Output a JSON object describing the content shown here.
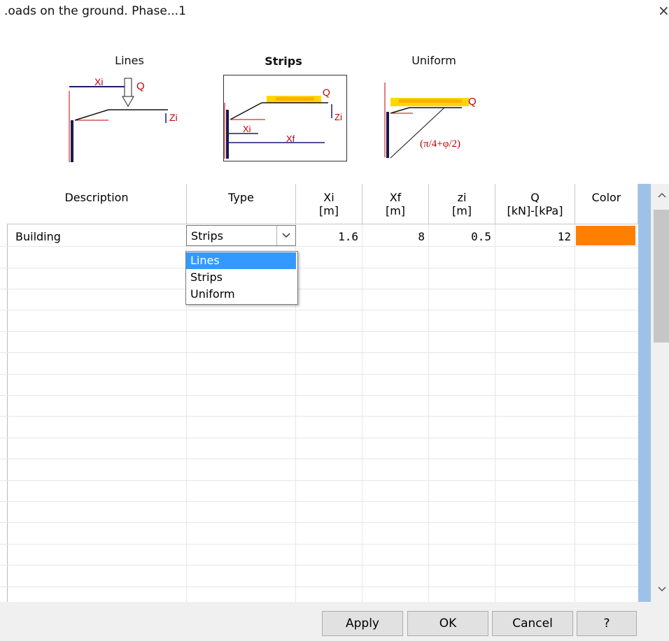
{
  "window": {
    "title": ".oads on the ground. Phase...1",
    "close_glyph": "×"
  },
  "diagrams": [
    {
      "label": "Lines",
      "bold": false,
      "labels": {
        "xi": "Xi",
        "q": "Q",
        "zi": "Zi"
      }
    },
    {
      "label": "Strips",
      "bold": true,
      "labels": {
        "xi": "Xi",
        "xf": "Xf",
        "q": "Q",
        "zi": "Zi"
      }
    },
    {
      "label": "Uniform",
      "bold": false,
      "labels": {
        "q": "Q",
        "angle": "(π/4+φ/2)"
      }
    }
  ],
  "table": {
    "columns": [
      {
        "label": "Description",
        "unit": ""
      },
      {
        "label": "Type",
        "unit": ""
      },
      {
        "label": "Xi",
        "unit": "[m]"
      },
      {
        "label": "Xf",
        "unit": "[m]"
      },
      {
        "label": "zi",
        "unit": "[m]"
      },
      {
        "label": "Q",
        "unit": "[kN]-[kPa]"
      },
      {
        "label": "Color",
        "unit": ""
      }
    ],
    "rows": [
      {
        "description": "Building",
        "type": "Strips",
        "xi": "1.6",
        "xf": "8",
        "zi": "0.5",
        "q": "12",
        "color": "#ff8000"
      }
    ]
  },
  "type_dropdown": {
    "options": [
      "Lines",
      "Strips",
      "Uniform"
    ],
    "highlighted": "Lines"
  },
  "buttons": {
    "apply": "Apply",
    "ok": "OK",
    "cancel": "Cancel",
    "help": "?"
  },
  "colors": {
    "selection": "#3399ff",
    "scrollbar_accent": "#9ec1ea",
    "red_lines": "#c00000",
    "load_yellow": "#ffd700"
  }
}
